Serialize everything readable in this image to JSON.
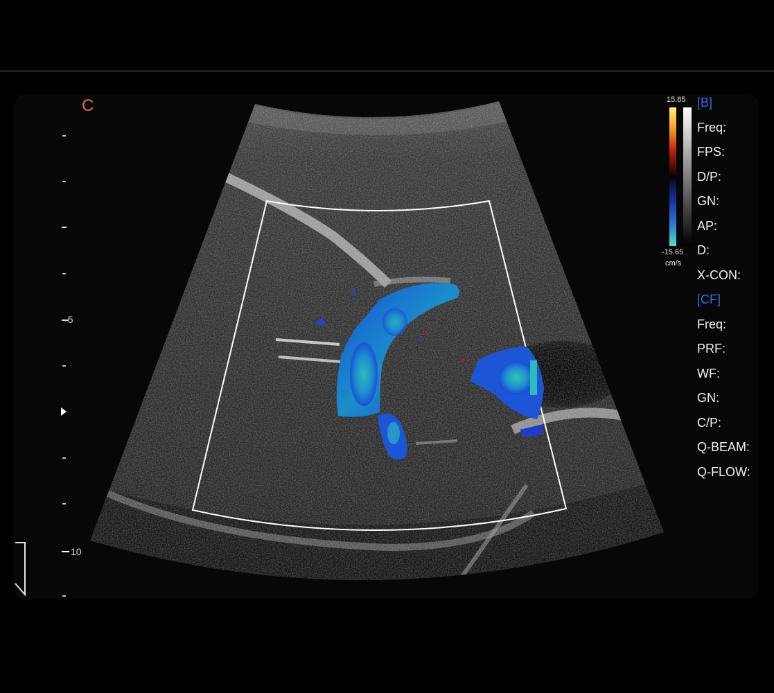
{
  "mode": {
    "letter": "C"
  },
  "depth_scale": {
    "labels": [
      "5",
      "10"
    ]
  },
  "color_scale": {
    "top": "15.65",
    "bottom": "-15.65",
    "unit": "cm/s"
  },
  "parameters": {
    "b_mode": {
      "header": "[B]",
      "items": [
        "Freq:",
        "FPS:",
        "D/P:",
        "GN:",
        "AP:",
        "D:",
        "X-CON:"
      ]
    },
    "cf_mode": {
      "header": "[CF]",
      "items": [
        "Freq:",
        "PRF:",
        "WF:",
        "GN:",
        "C/P:",
        "Q-BEAM:",
        "Q-FLOW:"
      ]
    }
  },
  "colors": {
    "mode_letter": "#d8793a",
    "header_blue": "#2f6fe0",
    "text": "#f2f2f2",
    "roi_box": "#ffffff"
  }
}
